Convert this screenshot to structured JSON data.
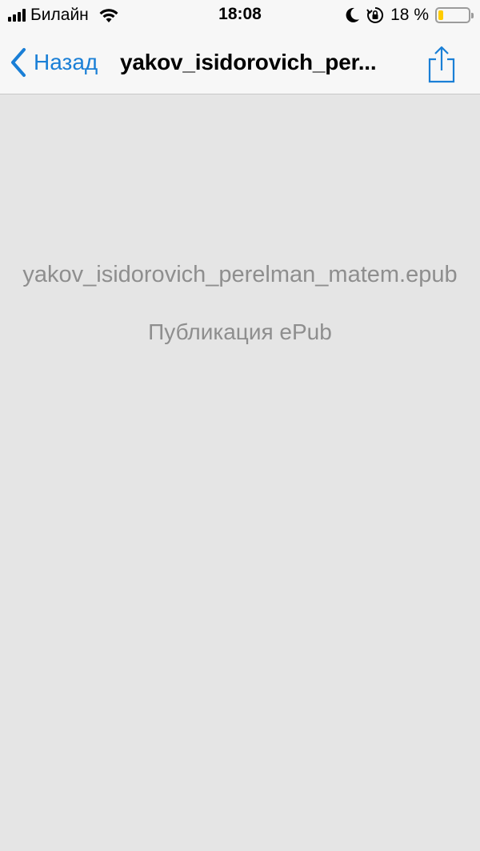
{
  "status_bar": {
    "carrier": "Билайн",
    "time": "18:08",
    "battery_percent": "18 %",
    "battery_level": 0.18,
    "battery_color": "#ffcc00",
    "icons": [
      "signal-icon",
      "wifi-icon",
      "moon-icon",
      "orientation-lock-icon",
      "battery-icon"
    ]
  },
  "nav": {
    "back_label": "Назад",
    "title": "yakov_isidorovich_per...",
    "accent_color": "#1a7fd6",
    "share_icon": "share-icon"
  },
  "preview": {
    "file_name": "yakov_isidorovich_perelman_matem.epub",
    "file_type": "Публикация ePub"
  }
}
